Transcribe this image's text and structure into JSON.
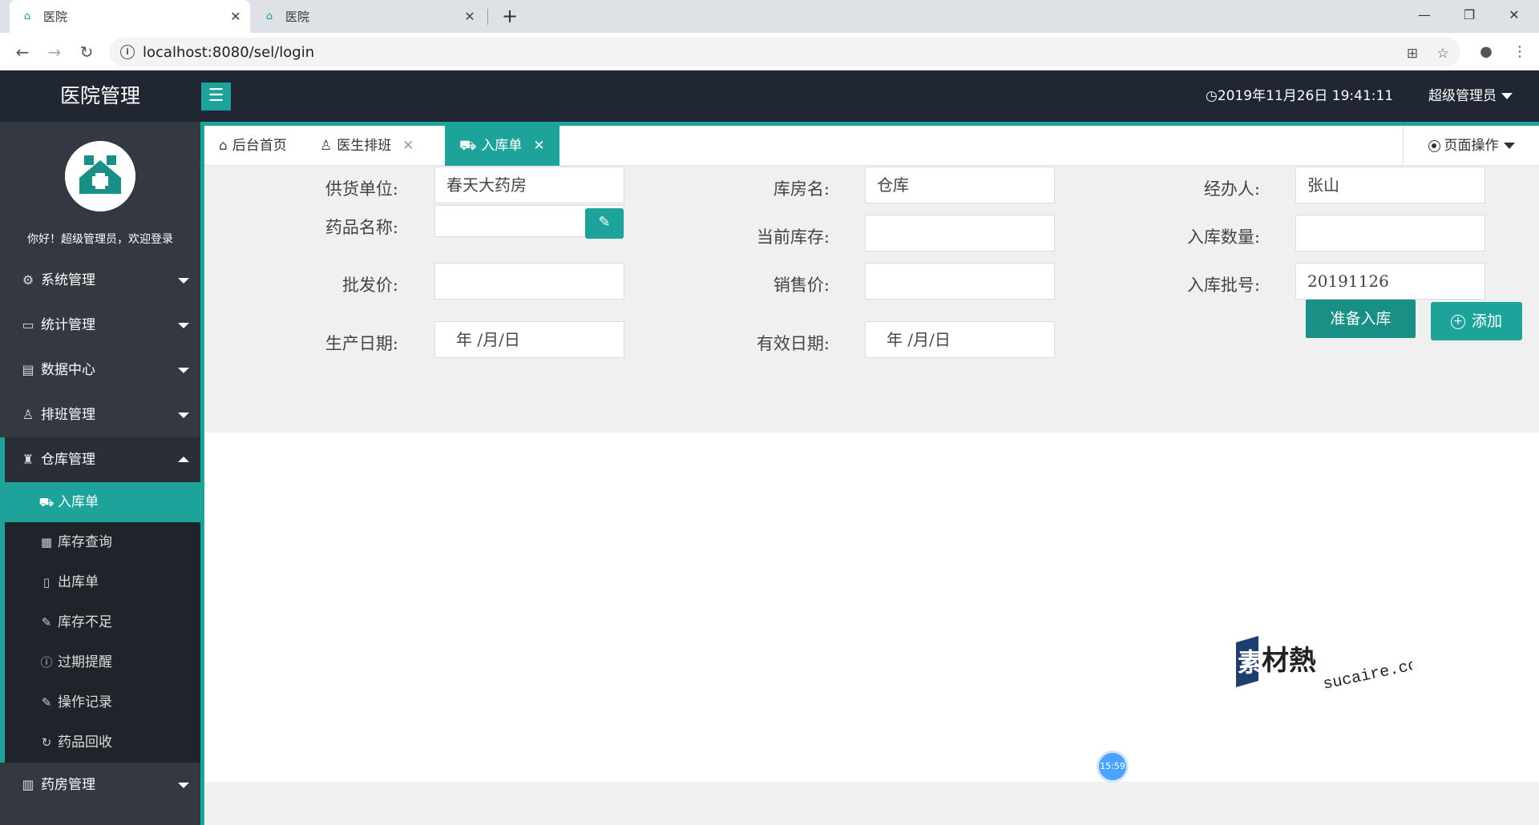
{
  "browser": {
    "tabs": [
      {
        "title": "医院",
        "active": true
      },
      {
        "title": "医院",
        "active": false
      }
    ],
    "url": "localhost:8080/sel/login"
  },
  "header": {
    "brand": "医院管理",
    "datetime": "2019年11月26日 19:41:11",
    "user": "超级管理员"
  },
  "sidebar": {
    "welcome": "你好！超级管理员，欢迎登录",
    "menu": [
      {
        "label": "系统管理",
        "icon": "gear-icon"
      },
      {
        "label": "统计管理",
        "icon": "monitor-icon"
      },
      {
        "label": "数据中心",
        "icon": "document-icon"
      },
      {
        "label": "排班管理",
        "icon": "user-icon"
      },
      {
        "label": "仓库管理",
        "icon": "warehouse-icon",
        "open": true
      }
    ],
    "submenu": [
      {
        "label": "入库单",
        "icon": "cart-icon",
        "active": true
      },
      {
        "label": "库存查询",
        "icon": "calendar-icon"
      },
      {
        "label": "出库单",
        "icon": "file-icon"
      },
      {
        "label": "库存不足",
        "icon": "edit-icon"
      },
      {
        "label": "过期提醒",
        "icon": "info-icon"
      },
      {
        "label": "操作记录",
        "icon": "edit-icon"
      },
      {
        "label": "药品回收",
        "icon": "refresh-icon"
      }
    ],
    "menu_after": [
      {
        "label": "药房管理",
        "icon": "book-icon"
      }
    ]
  },
  "tabs": [
    {
      "label": "后台首页",
      "icon": "home-icon",
      "closable": false
    },
    {
      "label": "医生排班",
      "icon": "user-icon",
      "closable": true
    },
    {
      "label": "入库单",
      "icon": "cart-icon",
      "closable": true,
      "active": true
    }
  ],
  "page_ops": "页面操作",
  "form": {
    "supplier": {
      "label": "供货单位:",
      "value": "春天大药房"
    },
    "warehouse": {
      "label": "库房名:",
      "value": "仓库"
    },
    "handler": {
      "label": "经办人:",
      "value": "张山"
    },
    "drug_name": {
      "label": "药品名称:",
      "value": ""
    },
    "current_stock": {
      "label": "当前库存:",
      "value": ""
    },
    "in_qty": {
      "label": "入库数量:",
      "value": ""
    },
    "wholesale": {
      "label": "批发价:",
      "value": ""
    },
    "retail": {
      "label": "销售价:",
      "value": ""
    },
    "batch_no": {
      "label": "入库批号:",
      "value": "20191126"
    },
    "prod_date": {
      "label": "生产日期:",
      "value": "年 /月/日"
    },
    "exp_date": {
      "label": "有效日期:",
      "value": "年 /月/日"
    }
  },
  "buttons": {
    "prepare": "准备入库",
    "add": "添加"
  },
  "watermark": {
    "brand": "素材熱",
    "site": "sucaire.com"
  },
  "timer": "15:59",
  "colors": {
    "accent": "#1ea39b",
    "header": "#212732",
    "sidebar": "#333841"
  }
}
